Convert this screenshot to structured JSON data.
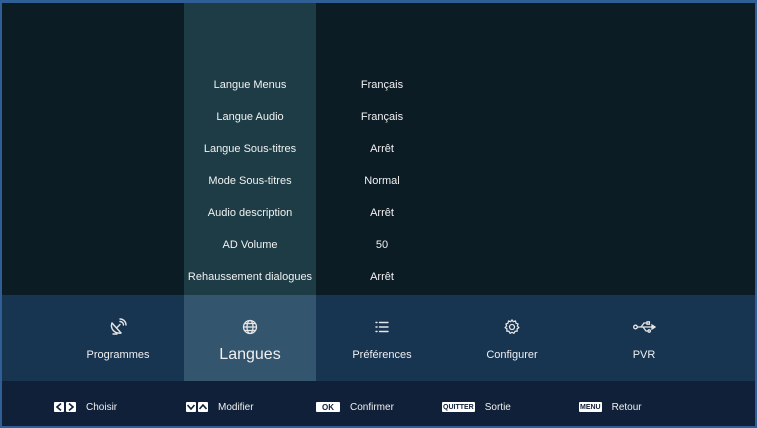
{
  "settings": [
    {
      "label": "Langue Menus",
      "value": "Français"
    },
    {
      "label": "Langue Audio",
      "value": "Français"
    },
    {
      "label": "Langue Sous-titres",
      "value": "Arrêt"
    },
    {
      "label": "Mode Sous-titres",
      "value": "Normal"
    },
    {
      "label": "Audio description",
      "value": "Arrêt"
    },
    {
      "label": "AD Volume",
      "value": "50"
    },
    {
      "label": "Rehaussement dialogues",
      "value": "Arrêt"
    }
  ],
  "tabs": [
    {
      "label": "Programmes",
      "icon": "satellite-dish-icon"
    },
    {
      "label": "Langues",
      "icon": "globe-icon",
      "active": true
    },
    {
      "label": "Préférences",
      "icon": "list-icon"
    },
    {
      "label": "Configurer",
      "icon": "gear-icon"
    },
    {
      "label": "PVR",
      "icon": "usb-icon"
    }
  ],
  "footer": {
    "choose": {
      "key": "",
      "label": "Choisir"
    },
    "modify": {
      "key": "",
      "label": "Modifier"
    },
    "confirm": {
      "key": "OK",
      "label": "Confirmer"
    },
    "exit": {
      "key": "QUITTER",
      "label": "Sortie"
    },
    "back": {
      "key": "MENU",
      "label": "Retour"
    }
  },
  "colors": {
    "background": "#0c1c25",
    "active_column": "#1d3c45",
    "tab_bar": "#173450",
    "active_tab": "#34556e",
    "footer": "#0f2038",
    "frame": "#2f5f95"
  }
}
